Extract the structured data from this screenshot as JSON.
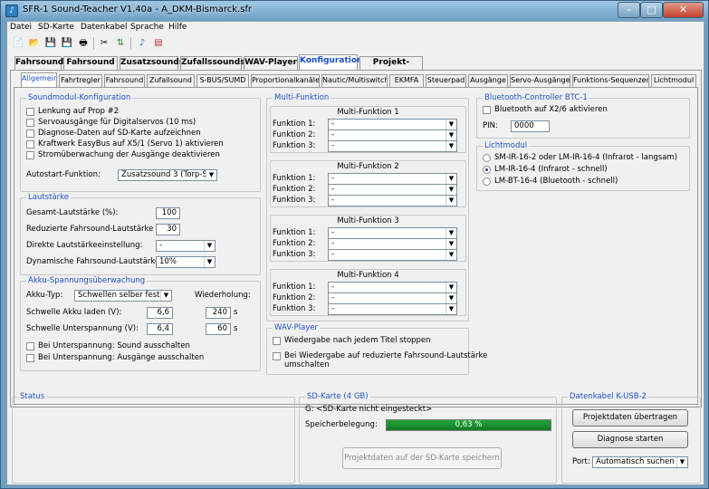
{
  "window": {
    "title": "SFR-1 Sound-Teacher V1.40a - A_DKM-Bismarck.sfr"
  },
  "menu": [
    "Datei",
    "SD-Karte",
    "Datenkabel",
    "Sprache",
    "Hilfe"
  ],
  "toolbar_icons": [
    "new-file-icon",
    "open-folder-icon",
    "save-icon",
    "save-as-icon",
    "print-icon",
    "cut-icon",
    "usb-connect-icon",
    "music-note-icon",
    "pdf-icon"
  ],
  "main_tabs": [
    "Fahrsound",
    "Fahrsound 2",
    "Zusatzsounds",
    "Zufallssounds",
    "WAV-Player",
    "Konfiguration",
    "Projekt-Notizen"
  ],
  "main_tab_active": "Konfiguration",
  "sub_tabs": [
    "Allgemein",
    "Fahrtregler",
    "Fahrsound",
    "Zufallsound",
    "S-BUS/SUMD",
    "Proportionalkanäle",
    "Nautic/Multiswitch",
    "EKMFA",
    "Steuerpad",
    "Ausgänge",
    "Servo-Ausgänge",
    "Funktions-Sequenzen",
    "Lichtmodul"
  ],
  "sub_tab_active": "Allgemein",
  "soundmodul": {
    "title": "Soundmodul-Konfiguration",
    "checkboxes": [
      {
        "label": "Lenkung auf Prop #2",
        "checked": false
      },
      {
        "label": "Servoausgänge für Digitalservos (10 ms)",
        "checked": false
      },
      {
        "label": "Diagnose-Daten auf SD-Karte aufzeichnen",
        "checked": false
      },
      {
        "label": "Kraftwerk EasyBus auf X5/1 (Servo 1) aktivieren",
        "checked": false
      },
      {
        "label": "Stromüberwachung der Ausgänge deaktivieren",
        "checked": false
      }
    ],
    "autostart_label": "Autostart-Funktion:",
    "autostart_value": "Zusatzsound 3 (Torp-Schi"
  },
  "lautstaerke": {
    "title": "Lautstärke",
    "gesamt_label": "Gesamt-Lautstärke (%):",
    "gesamt_value": "100",
    "reduziert_label": "Reduzierte Fahrsound-Lautstärke (%):",
    "reduziert_value": "30",
    "direkt_label": "Direkte Lautstärkeeinstellung:",
    "direkt_value": "-",
    "dynamisch_label": "Dynamische Fahrsound-Lautstärke:",
    "dynamisch_value": "10%"
  },
  "akku": {
    "title": "Akku-Spannungsüberwachung",
    "typ_label": "Akku-Typ:",
    "typ_value": "Schwellen selber festlege",
    "wiederholung_label": "Wiederholung:",
    "laden_label": "Schwelle Akku laden (V):",
    "laden_value": "6,6",
    "laden_rep": "240",
    "unter_label": "Schwelle Unterspannung (V):",
    "unter_value": "6,4",
    "unter_rep": "60",
    "unit_s": "s",
    "checkboxes": [
      {
        "label": "Bei Unterspannung: Sound ausschalten",
        "checked": false
      },
      {
        "label": "Bei Unterspannung: Ausgänge ausschalten",
        "checked": false
      }
    ]
  },
  "multifunktion": {
    "title": "Multi-Funktion",
    "blocks": [
      {
        "title": "Multi-Funktion 1",
        "rows": [
          {
            "label": "Funktion 1:",
            "value": "-"
          },
          {
            "label": "Funktion 2:",
            "value": "-"
          },
          {
            "label": "Funktion 3:",
            "value": "-"
          }
        ]
      },
      {
        "title": "Multi-Funktion 2",
        "rows": [
          {
            "label": "Funktion 1:",
            "value": "-"
          },
          {
            "label": "Funktion 2:",
            "value": "-"
          },
          {
            "label": "Funktion 3:",
            "value": "-"
          }
        ]
      },
      {
        "title": "Multi-Funktion 3",
        "rows": [
          {
            "label": "Funktion 1:",
            "value": "-"
          },
          {
            "label": "Funktion 2:",
            "value": "-"
          },
          {
            "label": "Funktion 3:",
            "value": "-"
          }
        ]
      },
      {
        "title": "Multi-Funktion 4",
        "rows": [
          {
            "label": "Funktion 1:",
            "value": "-"
          },
          {
            "label": "Funktion 2:",
            "value": "-"
          },
          {
            "label": "Funktion 3:",
            "value": "-"
          }
        ]
      }
    ]
  },
  "wavplayer": {
    "title": "WAV-Player",
    "checkboxes": [
      {
        "label": "Wiedergabe nach jedem Titel stoppen",
        "checked": false
      },
      {
        "label": "Bei Wiedergabe auf reduzierte Fahrsound-Lautstärke",
        "label2": "umschalten",
        "checked": false
      }
    ]
  },
  "bluetooth": {
    "title": "Bluetooth-Controller BTC-1",
    "checkbox_label": "Bluetooth auf X2/6 aktivieren",
    "checked": false,
    "pin_label": "PIN:",
    "pin_value": "0000"
  },
  "lichtmodul": {
    "title": "Lichtmodul",
    "options": [
      {
        "label": "SM-IR-16-2 oder LM-IR-16-4 (Infrarot - langsam)",
        "selected": false
      },
      {
        "label": "LM-IR-16-4 (Infrarot - schnell)",
        "selected": true
      },
      {
        "label": "LM-BT-16-4 (Bluetooth - schnell)",
        "selected": false
      }
    ]
  },
  "status": {
    "title": "Status"
  },
  "sdkarte": {
    "title": "SD-Karte (4 GB)",
    "drive_text": "G: <SD-Karte nicht eingesteckt>",
    "belegung_label": "Speicherbelegung:",
    "belegung_text": "0,63 %",
    "belegung_fraction": 1.0,
    "save_button": "Projektdaten auf der SD-Karte speichern"
  },
  "datenkabel": {
    "title": "Datenkabel K-USB-2",
    "transfer_button": "Projektdaten übertragen",
    "diagnose_button": "Diagnose starten",
    "port_label": "Port:",
    "port_value": "Automatisch suchen"
  }
}
